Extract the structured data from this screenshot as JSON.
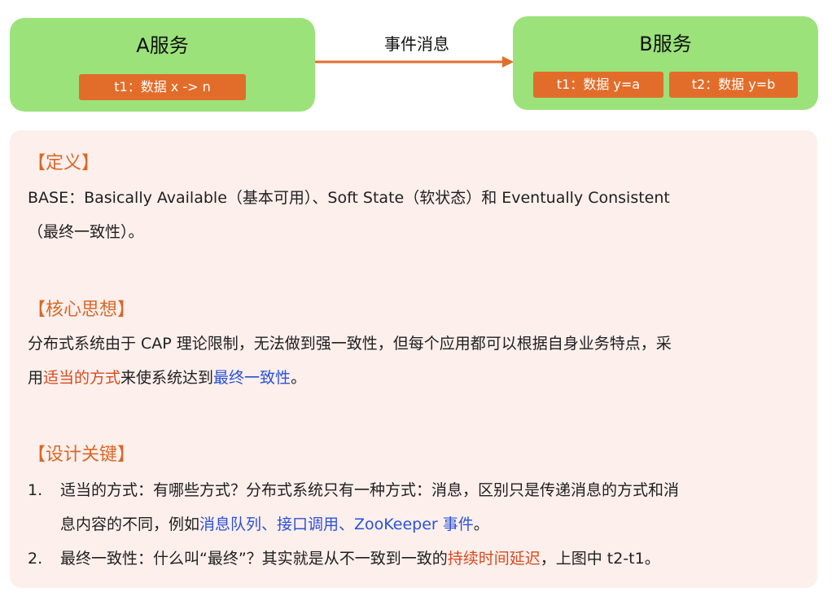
{
  "diagram": {
    "service_a": {
      "title": "A服务",
      "tags": [
        "t1：数据 x -> n"
      ]
    },
    "service_b": {
      "title": "B服务",
      "tags": [
        "t1：数据 y=a",
        "t2：数据 y=b"
      ]
    },
    "arrow_label": "事件消息",
    "colors": {
      "box": "#9be27a",
      "tag": "#e26d2a",
      "arrow": "#e26d2a",
      "panel": "#fcefec"
    }
  },
  "sections": {
    "definition": {
      "heading": "【定义】",
      "line1": "BASE：Basically Available（基本可用）、Soft State（软状态）和 Eventually Consistent",
      "line2": "（最终一致性）。"
    },
    "core": {
      "heading": "【核心思想】",
      "line1": "分布式系统由于 CAP 理论限制，无法做到强一致性，但每个应用都可以根据自身业务特点，采",
      "line2_a": "用",
      "line2_b": "适当的方式",
      "line2_c": "来使系统达到",
      "line2_d": "最终一致性",
      "line2_e": "。"
    },
    "design": {
      "heading": "【设计关键】",
      "items": [
        {
          "num": "1.",
          "line1": "适当的方式：有哪些方式？分布式系统只有一种方式：消息，区别只是传递消息的方式和消",
          "line2_a": "息内容的不同，例如",
          "line2_b": "消息队列、接口调用、ZooKeeper 事件",
          "line2_c": "。"
        },
        {
          "num": "2.",
          "text_a": "最终一致性：什么叫“最终”？其实就是从不一致到一致的",
          "text_b": "持续时间延迟",
          "text_c": "，上图中 t2-t1。"
        }
      ]
    }
  }
}
